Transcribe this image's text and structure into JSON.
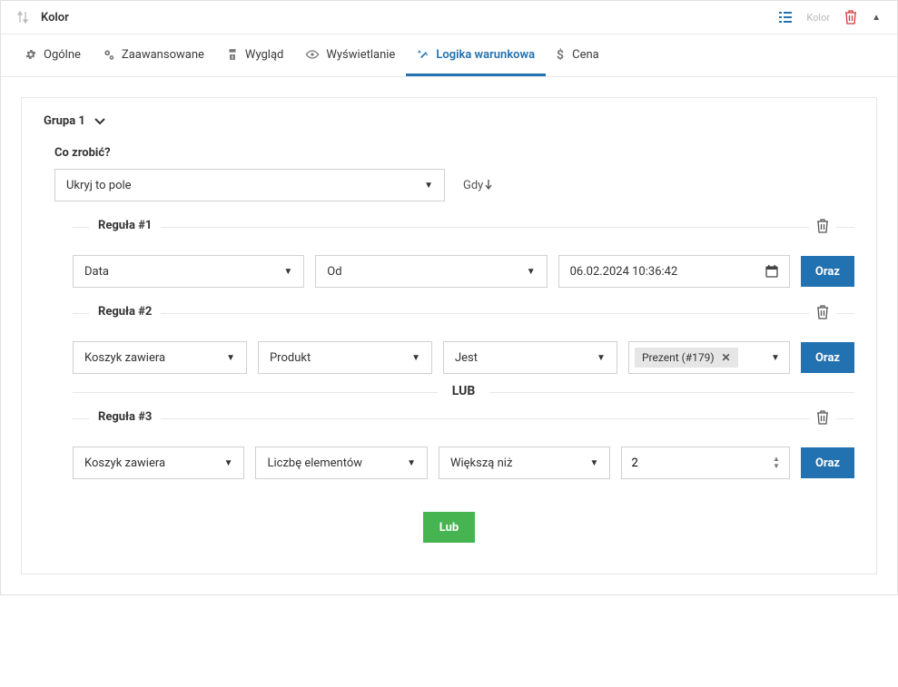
{
  "header": {
    "title": "Kolor",
    "mini_label": "Kolor",
    "sort_icon": "sort-icon",
    "list_icon": "list-icon",
    "trash_icon": "trash-icon",
    "collapse_icon": "caret-up"
  },
  "tabs": {
    "general": "Ogólne",
    "advanced": "Zaawansowane",
    "appearance": "Wygląd",
    "display": "Wyświetlanie",
    "conditional": "Logika warunkowa",
    "price": "Cena"
  },
  "group": {
    "label": "Grupa 1",
    "whattodo_label": "Co zrobić?",
    "action_value": "Ukryj to pole",
    "when_label": "Gdy"
  },
  "buttons": {
    "and": "Oraz",
    "or": "Lub"
  },
  "divider": {
    "or": "LUB"
  },
  "rule1": {
    "legend": "Reguła #1",
    "field": "Data",
    "op": "Od",
    "value": "06.02.2024 10:36:42"
  },
  "rule2": {
    "legend": "Reguła #2",
    "field": "Koszyk zawiera",
    "kind": "Produkt",
    "op": "Jest",
    "tag": "Prezent (#179)"
  },
  "rule3": {
    "legend": "Reguła #3",
    "field": "Koszyk zawiera",
    "kind": "Liczbę elementów",
    "op": "Większą niż",
    "value": "2"
  }
}
